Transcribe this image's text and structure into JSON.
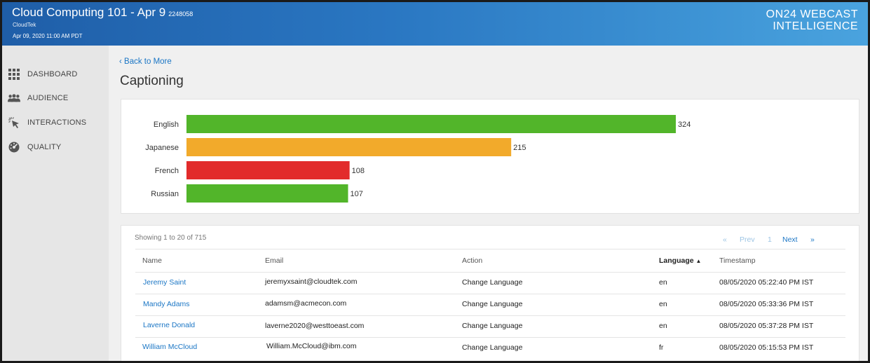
{
  "header": {
    "title": "Cloud Computing 101 - Apr 9",
    "event_id": "2248058",
    "org": "CloudTek",
    "datetime": "Apr 09, 2020 11:00 AM PDT",
    "brand_line1": "ON24 WEBCAST",
    "brand_line2": "INTELLIGENCE"
  },
  "sidebar": {
    "items": [
      {
        "label": "DASHBOARD",
        "icon": "grid-icon"
      },
      {
        "label": "AUDIENCE",
        "icon": "people-icon"
      },
      {
        "label": "INTERACTIONS",
        "icon": "cursor-click-icon"
      },
      {
        "label": "QUALITY",
        "icon": "gauge-icon"
      }
    ]
  },
  "page": {
    "back_link": "Back to More",
    "title": "Captioning"
  },
  "chart_data": {
    "type": "bar",
    "orientation": "horizontal",
    "categories": [
      "English",
      "Japanese",
      "French",
      "Russian"
    ],
    "values": [
      324,
      215,
      108,
      107
    ],
    "colors": [
      "#52b52a",
      "#f2aa2b",
      "#e22b2b",
      "#52b52a"
    ],
    "title": "",
    "xlabel": "",
    "ylabel": "",
    "data_labels": true
  },
  "table": {
    "showing": "Showing 1 to 20 of 715",
    "pager": {
      "first": "«",
      "prev": "Prev",
      "page": "1",
      "next": "Next",
      "last": "»"
    },
    "columns": [
      "Name",
      "Email",
      "Action",
      "Language",
      "Timestamp"
    ],
    "sort_indicator": "▲",
    "rows": [
      {
        "name": "Jeremy Saint",
        "email": "jeremyxsaint@cloudtek.com",
        "action": "Change Language",
        "language": "en",
        "timestamp": "08/05/2020 05:22:40 PM IST"
      },
      {
        "name": "Mandy Adams",
        "email": "adamsm@acmecon.com",
        "action": "Change Language",
        "language": "en",
        "timestamp": "08/05/2020 05:33:36 PM IST"
      },
      {
        "name": "Laverne Donald",
        "email": "laverne2020@westtoeast.com",
        "action": "Change Language",
        "language": "en",
        "timestamp": "08/05/2020 05:37:28 PM IST"
      },
      {
        "name": "William McCloud",
        "email": "William.McCloud@ibm.com",
        "action": "Change Language",
        "language": "fr",
        "timestamp": "08/05/2020 05:15:53 PM IST"
      }
    ]
  }
}
